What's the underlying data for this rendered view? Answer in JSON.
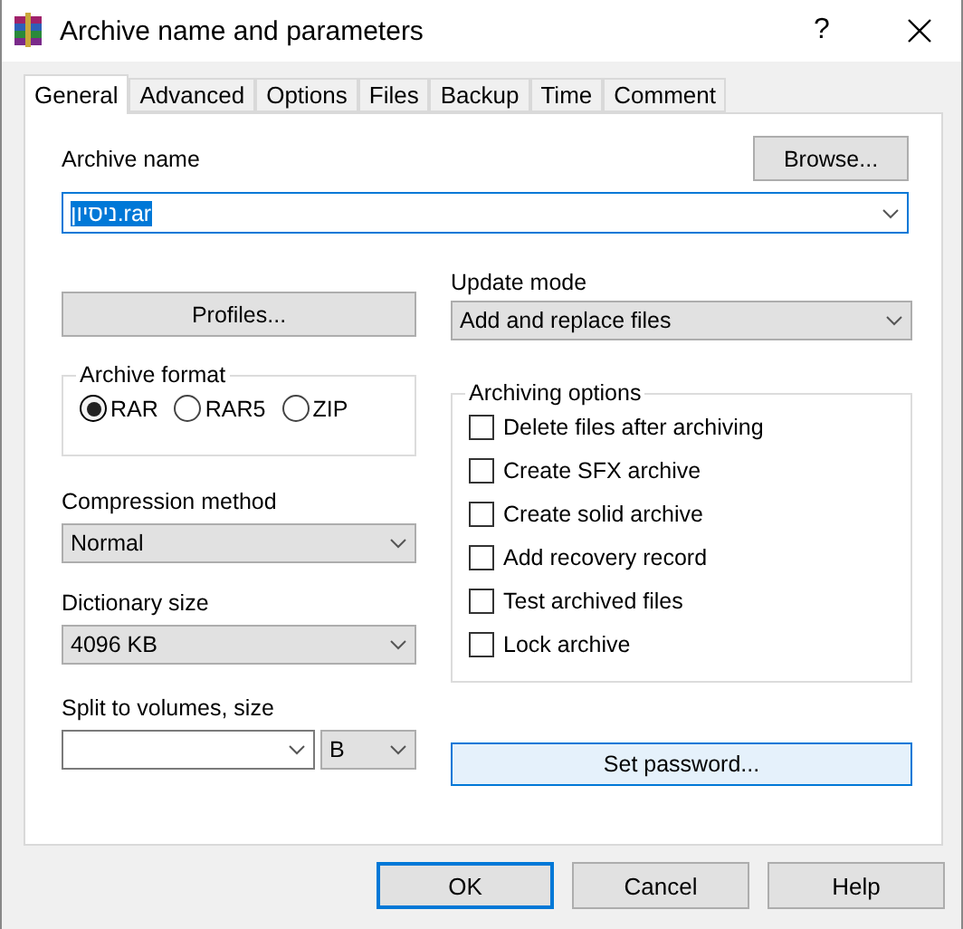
{
  "window": {
    "title": "Archive name and parameters",
    "help": "?"
  },
  "tabs": [
    {
      "label": "General",
      "selected": true
    },
    {
      "label": "Advanced",
      "selected": false
    },
    {
      "label": "Options",
      "selected": false
    },
    {
      "label": "Files",
      "selected": false
    },
    {
      "label": "Backup",
      "selected": false
    },
    {
      "label": "Time",
      "selected": false
    },
    {
      "label": "Comment",
      "selected": false
    }
  ],
  "archive_name": {
    "label": "Archive name",
    "value": "ניסיון.rar",
    "text_selected": true,
    "browse": "Browse..."
  },
  "profiles": "Profiles...",
  "update_mode": {
    "label": "Update mode",
    "value": "Add and replace files"
  },
  "archive_format": {
    "label": "Archive format",
    "options": [
      {
        "label": "RAR",
        "selected": true
      },
      {
        "label": "RAR5",
        "selected": false
      },
      {
        "label": "ZIP",
        "selected": false
      }
    ]
  },
  "compression_method": {
    "label": "Compression method",
    "value": "Normal"
  },
  "dictionary_size": {
    "label": "Dictionary size",
    "value": "4096 KB"
  },
  "split": {
    "label": "Split to volumes, size",
    "unit": "B"
  },
  "archiving_options": {
    "label": "Archiving options",
    "items": [
      {
        "label": "Delete files after archiving",
        "checked": false
      },
      {
        "label": "Create SFX archive",
        "checked": false
      },
      {
        "label": "Create solid archive",
        "checked": false
      },
      {
        "label": "Add recovery record",
        "checked": false
      },
      {
        "label": "Test archived files",
        "checked": false
      },
      {
        "label": "Lock archive",
        "checked": false
      }
    ]
  },
  "set_password": "Set password...",
  "buttons": [
    {
      "label": "OK",
      "default": true
    },
    {
      "label": "Cancel",
      "default": false
    },
    {
      "label": "Help",
      "default": false
    }
  ]
}
